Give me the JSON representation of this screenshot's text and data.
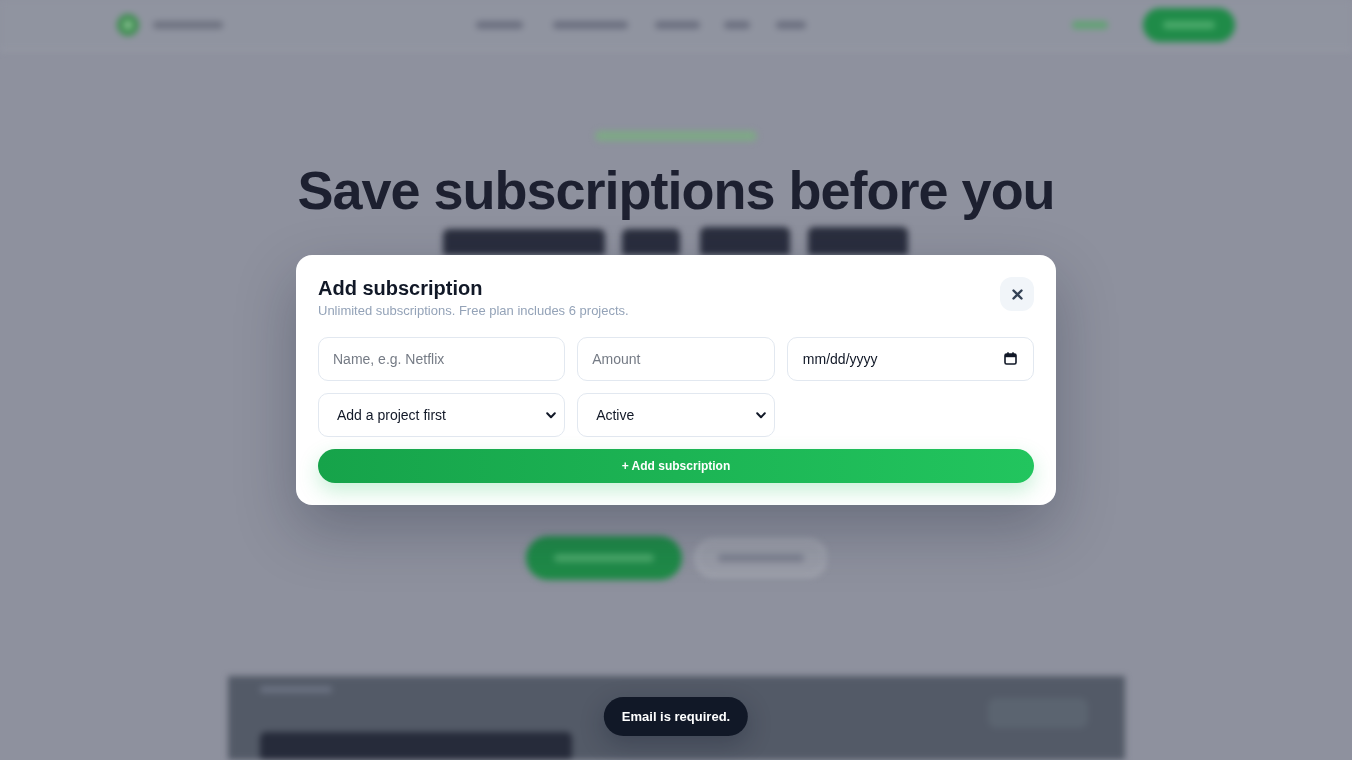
{
  "background_page": {
    "headline": "Save subscriptions before you"
  },
  "dialog": {
    "title": "Add subscription",
    "subtitle": "Unlimited subscriptions. Free plan includes 6 projects.",
    "fields": [
      {
        "kind": "text",
        "placeholder": "Name, e.g. Netflix"
      },
      {
        "kind": "text",
        "placeholder": "Amount"
      },
      {
        "kind": "date",
        "placeholder": "mm/dd/yyyy"
      },
      {
        "kind": "select",
        "value": "Add a project first"
      },
      {
        "kind": "select",
        "value": "Active"
      }
    ],
    "submit_button": {
      "label": "+ Add subscription"
    }
  },
  "toast": {
    "message": "Email is required."
  }
}
